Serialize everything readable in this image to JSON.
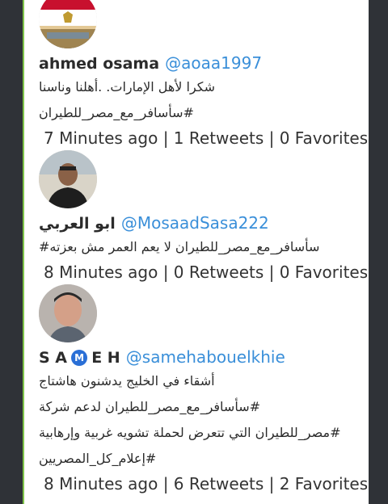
{
  "tweets": [
    {
      "name": "ahmed osama",
      "handle": "@aoaa1997",
      "avatar": "egypt-flag-avatar",
      "lines": [
        "شكرا لأهل الإمارات. .أهلنا وناسنا",
        "#سأسافر_مع_مصر_للطيران"
      ],
      "meta": "7 Minutes ago | 1 Retweets | 0 Favorites"
    },
    {
      "name": "ابو العربي",
      "handle": "@MosaadSasa222",
      "avatar": "man-dark-shirt-avatar",
      "lines": [
        "سأسافر_مع_مصر_للطيران لا يعم العمر مش بعزته#"
      ],
      "meta": "8 Minutes ago | 0 Retweets | 0 Favorites"
    },
    {
      "name_left": "S A",
      "name_badge": "M",
      "name_right": "E H",
      "handle": "@samehabouelkhie",
      "avatar": "man-portrait-avatar",
      "lines": [
        "أشقاء في الخليج يدشنون هاشتاج",
        "#سأسافر_مع_مصر_للطيران لدعم شركة",
        "#مصر_للطيران التي تتعرض لحملة تشويه غربية وإرهابية",
        "#إعلام_كل_المصريين"
      ],
      "meta": "8 Minutes ago | 6 Retweets | 2 Favorites"
    }
  ],
  "colors": {
    "accent_border": "#7fc34a",
    "handle": "#3a8fd9",
    "side_panel": "#2f3237"
  }
}
